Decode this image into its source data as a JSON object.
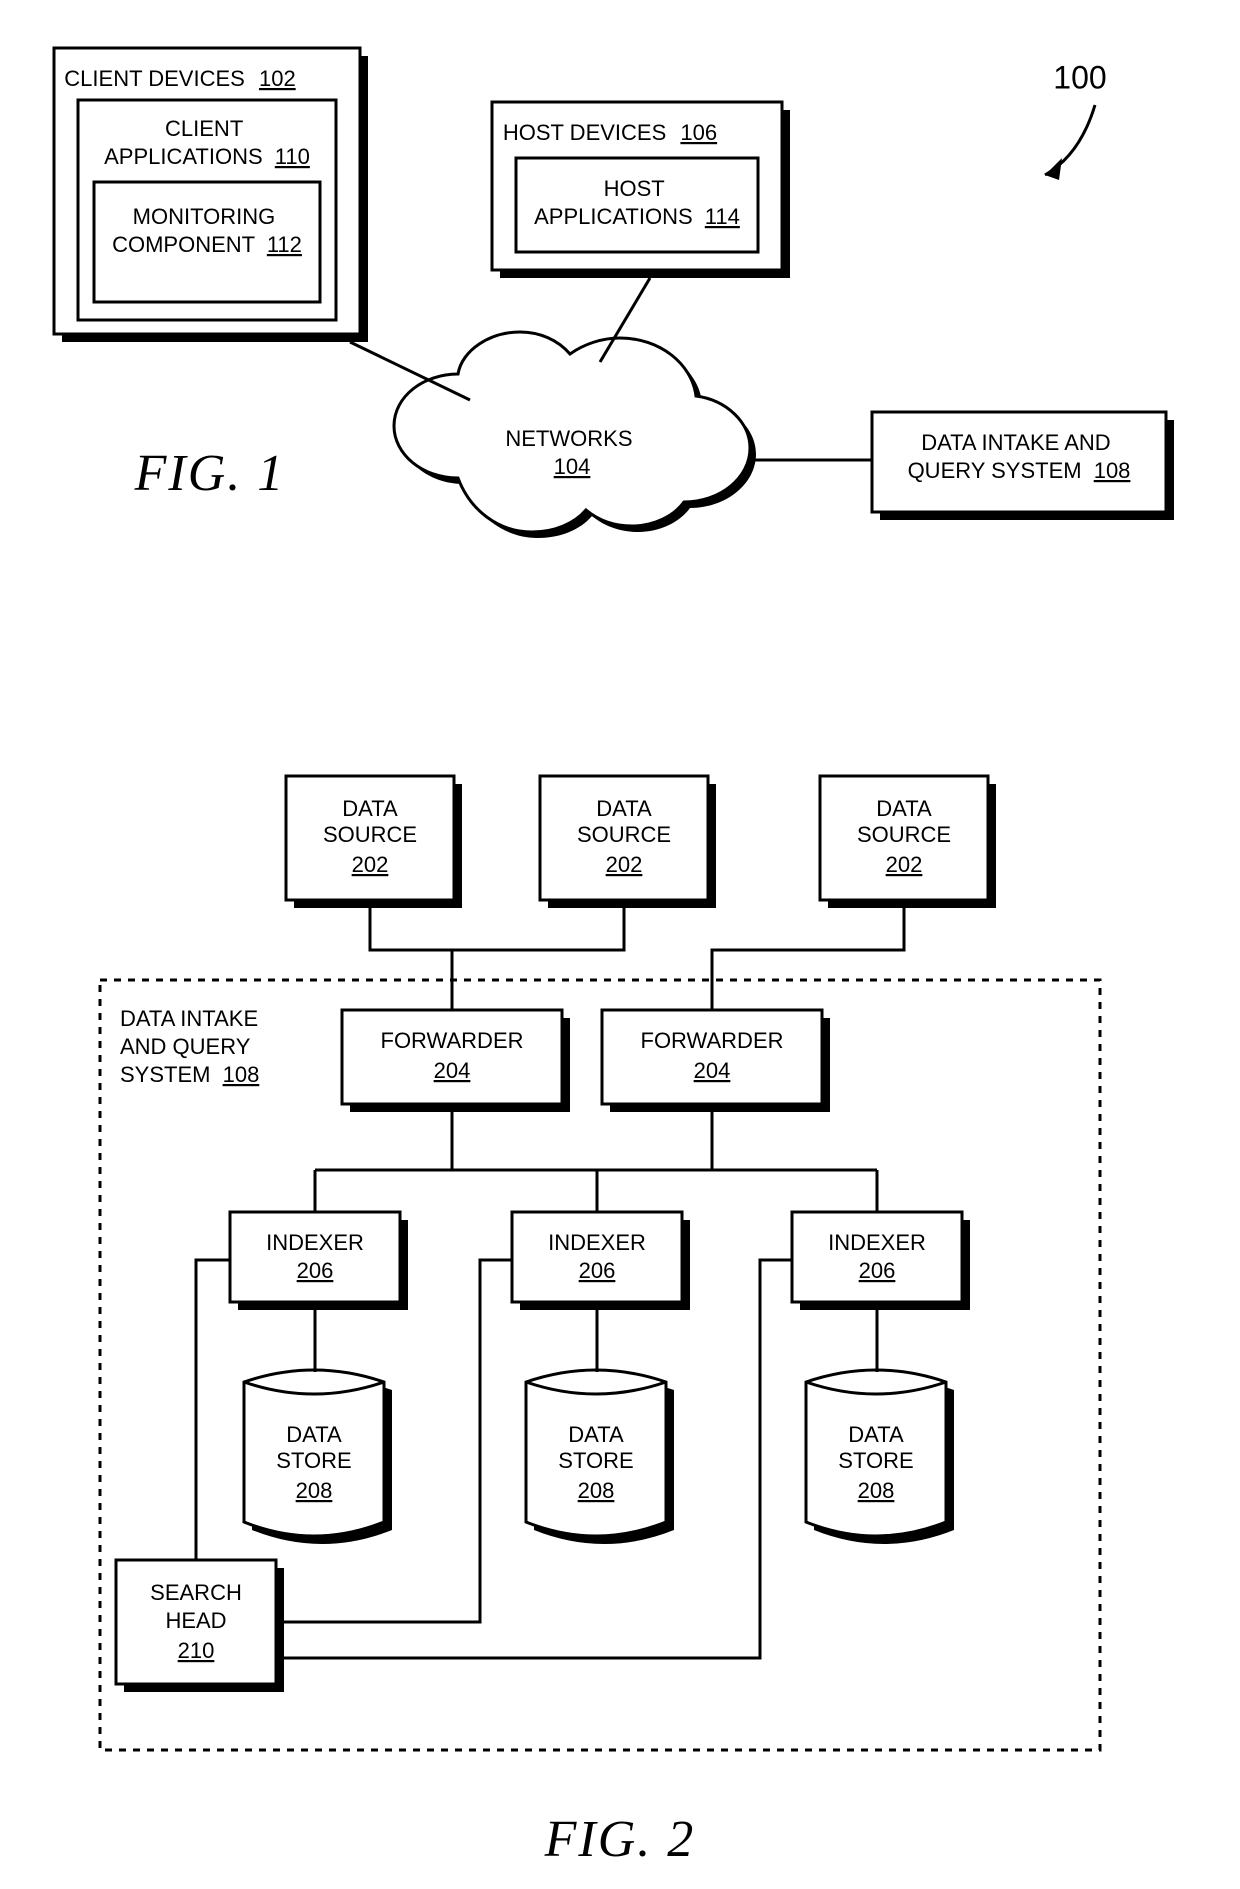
{
  "fig1": {
    "caption": "FIG. 1",
    "refnum": "100",
    "client_devices": {
      "label": "CLIENT DEVICES",
      "ref": "102"
    },
    "client_apps": {
      "label": "CLIENT\nAPPLICATIONS",
      "ref": "110"
    },
    "monitoring": {
      "label": "MONITORING\nCOMPONENT",
      "ref": "112"
    },
    "host_devices": {
      "label": "HOST DEVICES",
      "ref": "106"
    },
    "host_apps": {
      "label": "HOST\nAPPLICATIONS",
      "ref": "114"
    },
    "networks": {
      "label": "NETWORKS",
      "ref": "104"
    },
    "diqs": {
      "label": "DATA INTAKE AND\nQUERY SYSTEM",
      "ref": "108"
    }
  },
  "fig2": {
    "caption": "FIG. 2",
    "system_label": "DATA INTAKE\nAND QUERY\nSYSTEM",
    "system_ref": "108",
    "data_source": {
      "label": "DATA\nSOURCE",
      "ref": "202"
    },
    "forwarder": {
      "label": "FORWARDER",
      "ref": "204"
    },
    "indexer": {
      "label": "INDEXER",
      "ref": "206"
    },
    "data_store": {
      "label": "DATA\nSTORE",
      "ref": "208"
    },
    "search_head": {
      "label": "SEARCH\nHEAD",
      "ref": "210"
    }
  }
}
